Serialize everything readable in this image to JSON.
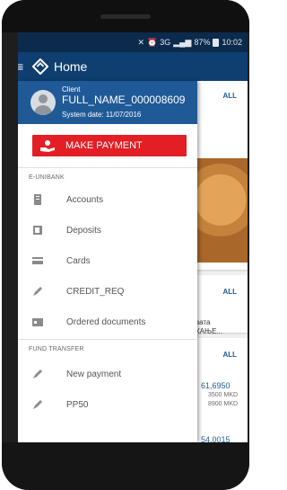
{
  "status_bar": {
    "network": "3G",
    "battery": "87%",
    "time": "10:02"
  },
  "app_bar": {
    "title": "Home"
  },
  "drawer": {
    "role": "Client",
    "name": "FULL_NAME_000008609",
    "system_date": "System date: 11/07/2016",
    "make_payment": "MAKE PAYMENT",
    "sections": [
      {
        "title": "E-UNIBANK",
        "items": [
          {
            "label": "Accounts",
            "icon": "accounts-icon"
          },
          {
            "label": "Deposits",
            "icon": "deposits-icon"
          },
          {
            "label": "Cards",
            "icon": "cards-icon"
          },
          {
            "label": "CREDIT_REQ",
            "icon": "pen-icon"
          },
          {
            "label": "Ordered documents",
            "icon": "documents-icon"
          }
        ]
      },
      {
        "title": "FUND TRANSFER",
        "items": [
          {
            "label": "New payment",
            "icon": "pen-icon"
          },
          {
            "label": "PP50",
            "icon": "pen-icon"
          }
        ]
      }
    ]
  },
  "background": {
    "all_1": "ALL",
    "all_2": "ALL",
    "all_3": "ALL",
    "text_1": "вата",
    "text_2": "КАЊЕ...",
    "rate_1": "61,6950",
    "small_1": "3500 MKD",
    "small_2": "8900 MKD",
    "rate_2": "54,0015"
  },
  "colors": {
    "app_bar": "#0f3f70",
    "drawer_header": "#1f5a97",
    "make_payment": "#e31e24"
  }
}
